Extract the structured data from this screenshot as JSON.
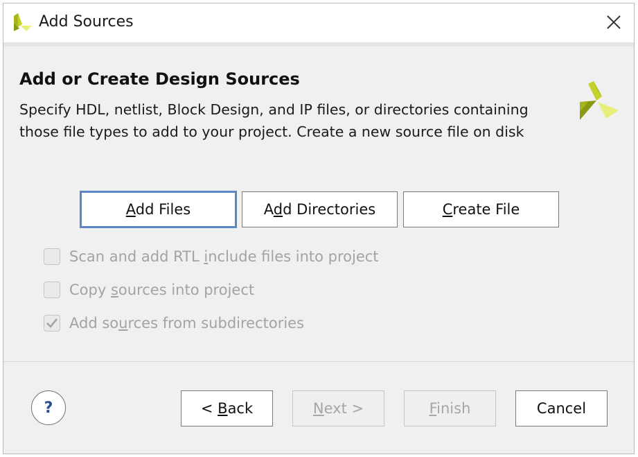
{
  "window": {
    "title": "Add Sources",
    "close_glyph": "✕",
    "icon": "vivado-logo-icon"
  },
  "header": {
    "title": "Add or Create Design Sources",
    "description": "Specify HDL, netlist, Block Design, and IP files, or directories containing those file types to add to your project. Create a new source file on disk",
    "logo": "vivado-logo-icon"
  },
  "actions": {
    "add_files": {
      "pre": "",
      "mnemonic": "A",
      "post": "dd Files"
    },
    "add_directories": {
      "pre": "A",
      "mnemonic": "d",
      "post": "d Directories"
    },
    "create_file": {
      "pre": "",
      "mnemonic": "C",
      "post": "reate File"
    }
  },
  "options": {
    "scan_rtl": {
      "pre": "Scan and add RTL ",
      "mnemonic": "i",
      "post": "nclude files into project",
      "checked": false,
      "enabled": false
    },
    "copy_sources": {
      "pre": "Copy ",
      "mnemonic": "s",
      "post": "ources into project",
      "checked": false,
      "enabled": false
    },
    "add_subdirs": {
      "pre": "Add so",
      "mnemonic": "u",
      "post": "rces from subdirectories",
      "checked": true,
      "enabled": false
    }
  },
  "footer": {
    "help": "?",
    "back": {
      "pre": "< ",
      "mnemonic": "B",
      "post": "ack"
    },
    "next": {
      "pre": "",
      "mnemonic": "N",
      "post": "ext >",
      "enabled": false
    },
    "finish": {
      "pre": "",
      "mnemonic": "F",
      "post": "inish",
      "enabled": false
    },
    "cancel": "Cancel"
  },
  "colors": {
    "logo_dark": "#8a9a12",
    "logo_mid": "#c3d12a",
    "logo_light": "#e6ef7a",
    "focus_border": "#5a86c8"
  }
}
